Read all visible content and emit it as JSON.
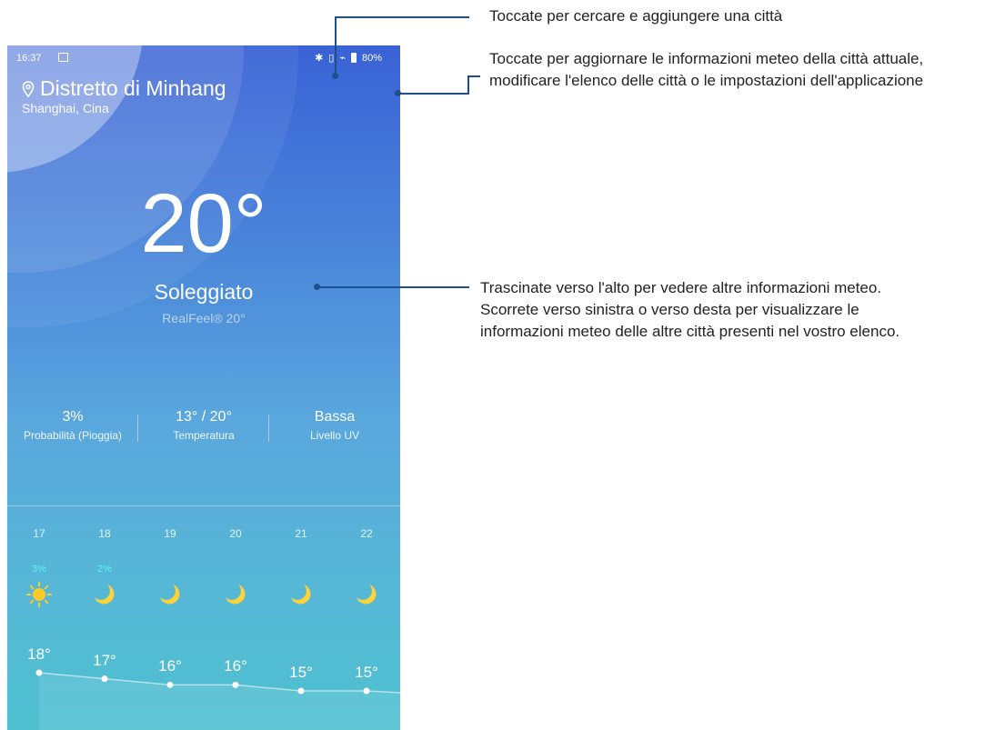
{
  "status_bar": {
    "time": "16:37",
    "battery": "80%"
  },
  "location": {
    "city": "Distretto di Minhang",
    "country": "Shanghai, Cina"
  },
  "current": {
    "temperature": "20°",
    "condition": "Soleggiato",
    "realfeel": "RealFeel® 20°"
  },
  "stats": [
    {
      "value": "3%",
      "label": "Probabilità (Pioggia)"
    },
    {
      "value": "13° / 20°",
      "label": "Temperatura"
    },
    {
      "value": "Bassa",
      "label": "Livello UV"
    }
  ],
  "forecast": [
    {
      "day": "17",
      "precip": "3%",
      "icon": "sun-icon",
      "temp": "18°"
    },
    {
      "day": "18",
      "precip": "2%",
      "icon": "moon-icon",
      "temp": "17°"
    },
    {
      "day": "19",
      "precip": "",
      "icon": "moon-icon",
      "temp": "16°"
    },
    {
      "day": "20",
      "precip": "",
      "icon": "moon-icon",
      "temp": "16°"
    },
    {
      "day": "21",
      "precip": "",
      "icon": "moon-icon",
      "temp": "15°"
    },
    {
      "day": "22",
      "precip": "",
      "icon": "moon-icon",
      "temp": "15°"
    }
  ],
  "annotations": {
    "search": "Toccate per cercare e aggiungere una città",
    "menu_line1": "Toccate per aggiornare le informazioni meteo della città attuale,",
    "menu_line2": "modificare l'elenco delle città o le impostazioni dell'applicazione",
    "swipe_line1": "Trascinate verso l'alto per vedere altre informazioni meteo.",
    "swipe_line2": "Scorrete verso sinistra o verso desta per visualizzare le",
    "swipe_line3": "informazioni meteo delle altre città presenti nel vostro elenco."
  },
  "colors": {
    "accent_line": "#1d4f8a",
    "precip": "#5ff2f0",
    "moon": "#ffd23a",
    "sun": "#ffc928"
  }
}
